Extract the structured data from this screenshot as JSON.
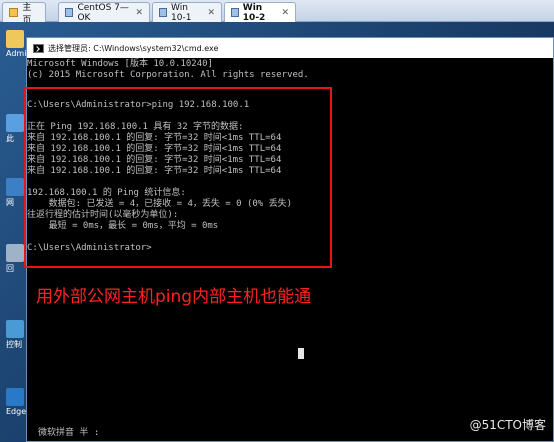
{
  "tabs": [
    {
      "label": "主页",
      "icon": "home-icon",
      "active": false
    },
    {
      "label": "CentOS 7—OK",
      "icon": "vm-icon",
      "active": false
    },
    {
      "label": "Win 10-1",
      "icon": "vm-icon",
      "active": false
    },
    {
      "label": "Win 10-2",
      "icon": "vm-icon",
      "active": true
    }
  ],
  "desktop_icons": [
    {
      "label": "Admi",
      "icon": "admin-folder-icon"
    },
    {
      "label": "此",
      "icon": "this-pc-icon"
    },
    {
      "label": "网",
      "icon": "network-icon"
    },
    {
      "label": "回",
      "icon": "recycle-bin-icon"
    },
    {
      "label": "控制",
      "icon": "control-panel-icon"
    },
    {
      "label": "Edge",
      "icon": "edge-icon"
    }
  ],
  "window": {
    "title": "选择管理员: C:\\Windows\\system32\\cmd.exe"
  },
  "console": {
    "lines": [
      "Microsoft Windows [版本 10.0.10240]",
      "(c) 2015 Microsoft Corporation. All rights reserved.",
      "",
      "C:\\Users\\Administrator>ping 192.168.100.1",
      "",
      "正在 Ping 192.168.100.1 具有 32 字节的数据:",
      "来自 192.168.100.1 的回复: 字节=32 时间<1ms TTL=64",
      "来自 192.168.100.1 的回复: 字节=32 时间<1ms TTL=64",
      "来自 192.168.100.1 的回复: 字节=32 时间<1ms TTL=64",
      "来自 192.168.100.1 的回复: 字节=32 时间<1ms TTL=64",
      "",
      "192.168.100.1 的 Ping 统计信息:",
      "    数据包: 已发送 = 4，已接收 = 4，丢失 = 0 (0% 丢失)",
      "往返行程的估计时间(以毫秒为单位):",
      "    最短 = 0ms，最长 = 0ms，平均 = 0ms",
      "",
      "C:\\Users\\Administrator>"
    ],
    "ime_status": "微软拼音 半 :"
  },
  "annotation": "用外部公网主机ping内部主机也能通",
  "watermark": "@51CTO博客",
  "colors": {
    "highlight_box": "#e8141b",
    "annotation_text": "#ff2222",
    "console_bg": "#000000",
    "console_text": "#c0c0c0"
  }
}
